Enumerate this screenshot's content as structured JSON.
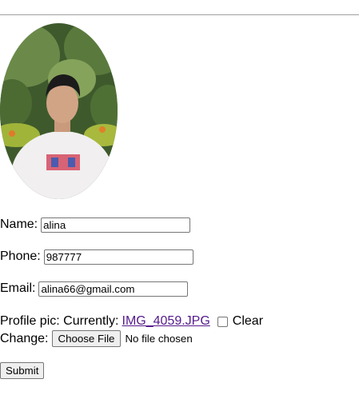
{
  "form": {
    "name_label": "Name:",
    "name_value": "alina",
    "phone_label": "Phone:",
    "phone_value": "987777",
    "email_label": "Email:",
    "email_value": "alina66@gmail.com",
    "profile_label": "Profile pic: Currently:",
    "current_file": "IMG_4059.JPG",
    "clear_label": "Clear",
    "change_label": "Change:",
    "choose_file_label": "Choose File",
    "no_file_text": "No file chosen",
    "submit_label": "Submit"
  },
  "profile_image": {
    "icon": "profile-photo"
  }
}
